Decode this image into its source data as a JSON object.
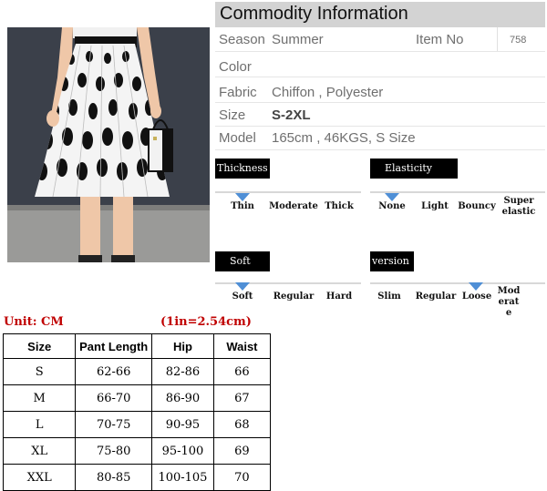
{
  "title": "Commodity Information",
  "info": {
    "season_label": "Season",
    "season_value": "Summer",
    "item_no_label": "Item No",
    "item_no_value": "758",
    "color_label": "Color",
    "fabric_label": "Fabric",
    "fabric_value": "Chiffon , Polyester",
    "size_label": "Size",
    "size_value": "S-2XL",
    "model_label": "Model",
    "model_value": "165cm , 46KGS, S Size"
  },
  "attributes": {
    "thickness": {
      "title": "Thickness",
      "options": [
        "Thin",
        "Moderate",
        "Thick"
      ],
      "selected": "Thin"
    },
    "elasticity": {
      "title": "Elasticity",
      "options": [
        "None",
        "Light",
        "Bouncy",
        "Super elastic"
      ],
      "selected": "None"
    },
    "soft": {
      "title": "Soft",
      "options": [
        "Soft",
        "Regular",
        "Hard"
      ],
      "selected": "Soft"
    },
    "version": {
      "title": "version",
      "options": [
        "Slim",
        "Regular",
        "Loose",
        "Moderate"
      ],
      "selected": "Loose"
    }
  },
  "size_chart": {
    "unit": "Unit: CM",
    "conversion": "(1in=2.54cm)",
    "headers": [
      "Size",
      "Pant Length",
      "Hip",
      "Waist"
    ],
    "rows": [
      [
        "S",
        "62-66",
        "82-86",
        "66"
      ],
      [
        "M",
        "66-70",
        "86-90",
        "67"
      ],
      [
        "L",
        "70-75",
        "90-95",
        "68"
      ],
      [
        "XL",
        "75-80",
        "95-100",
        "69"
      ],
      [
        "XXL",
        "80-85",
        "100-105",
        "70"
      ]
    ]
  },
  "colors": {
    "selector_triangle": "#4f8fd6",
    "unit_text": "#c00000",
    "header_bar": "#d3d3d3"
  }
}
